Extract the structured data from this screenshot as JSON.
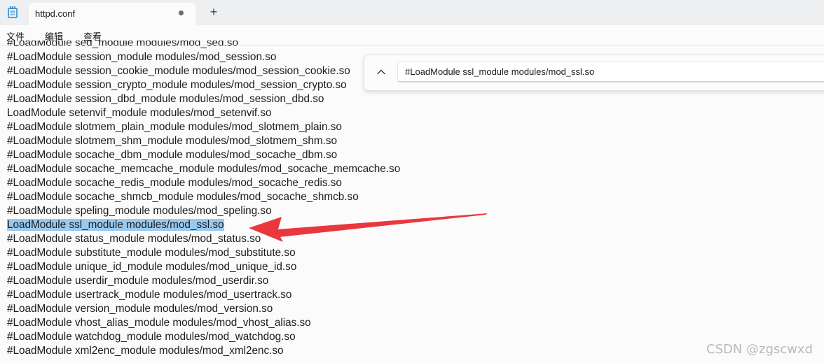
{
  "tab": {
    "title": "httpd.conf",
    "new_tab": "+"
  },
  "menu": [
    "文件",
    "编辑",
    "查看"
  ],
  "editor": {
    "lines": [
      "#LoadModule sed_module modules/mod_sed.so",
      "#LoadModule session_module modules/mod_session.so",
      "#LoadModule session_cookie_module modules/mod_session_cookie.so",
      "#LoadModule session_crypto_module modules/mod_session_crypto.so",
      "#LoadModule session_dbd_module modules/mod_session_dbd.so",
      "LoadModule setenvif_module modules/mod_setenvif.so",
      "#LoadModule slotmem_plain_module modules/mod_slotmem_plain.so",
      "#LoadModule slotmem_shm_module modules/mod_slotmem_shm.so",
      "#LoadModule socache_dbm_module modules/mod_socache_dbm.so",
      "#LoadModule socache_memcache_module modules/mod_socache_memcache.so",
      "#LoadModule socache_redis_module modules/mod_socache_redis.so",
      "#LoadModule socache_shmcb_module modules/mod_socache_shmcb.so",
      "#LoadModule speling_module modules/mod_speling.so",
      "LoadModule ssl_module modules/mod_ssl.so",
      "#LoadModule status_module modules/mod_status.so",
      "#LoadModule substitute_module modules/mod_substitute.so",
      "#LoadModule unique_id_module modules/mod_unique_id.so",
      "#LoadModule userdir_module modules/mod_userdir.so",
      "#LoadModule usertrack_module modules/mod_usertrack.so",
      "#LoadModule version_module modules/mod_version.so",
      "#LoadModule vhost_alias_module modules/mod_vhost_alias.so",
      "#LoadModule watchdog_module modules/mod_watchdog.so",
      "#LoadModule xml2enc_module modules/mod_xml2enc.so"
    ],
    "selected_line": 13
  },
  "find": {
    "value": "#LoadModule ssl_module modules/mod_ssl.so",
    "toggle_icon": "chevron-up-icon"
  },
  "watermark": "CSDN @zgscwxd",
  "colors": {
    "selection": "#99c9ef",
    "arrow": "#e8383d"
  }
}
